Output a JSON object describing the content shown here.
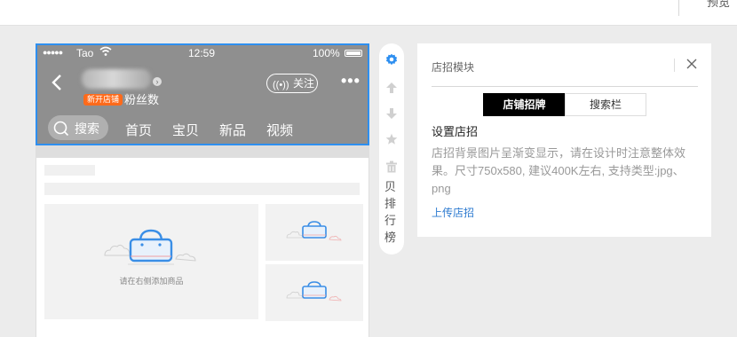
{
  "topbar": {
    "preview_label": "预览"
  },
  "phone": {
    "status": {
      "dots": "●●●●●",
      "carrier": "Tao",
      "time": "12:59",
      "battery": "100%"
    },
    "badge": "新开店铺",
    "fans_label": "粉丝数",
    "follow_label": "关注",
    "more_label": "•••",
    "search_label": "搜索",
    "tabs": [
      "首页",
      "宝贝",
      "新品",
      "视频"
    ]
  },
  "content": {
    "empty_hint": "请在右侧添加商品"
  },
  "tools": {
    "ranking_label": "贝排行榜"
  },
  "panel": {
    "title": "店招模块",
    "tabs": [
      "店铺招牌",
      "搜索栏"
    ],
    "heading": "设置店招",
    "description": "店招背景图片呈渐变显示，请在设计时注意整体效果。尺寸750x580, 建议400K左右, 支持类型:jpg、png",
    "upload_link": "上传店招"
  },
  "colors": {
    "accent_blue": "#2e8ff0",
    "badge_orange": "#ff6a1a",
    "link_blue": "#2e7bd0",
    "bag_blue": "#3a8ee6"
  }
}
